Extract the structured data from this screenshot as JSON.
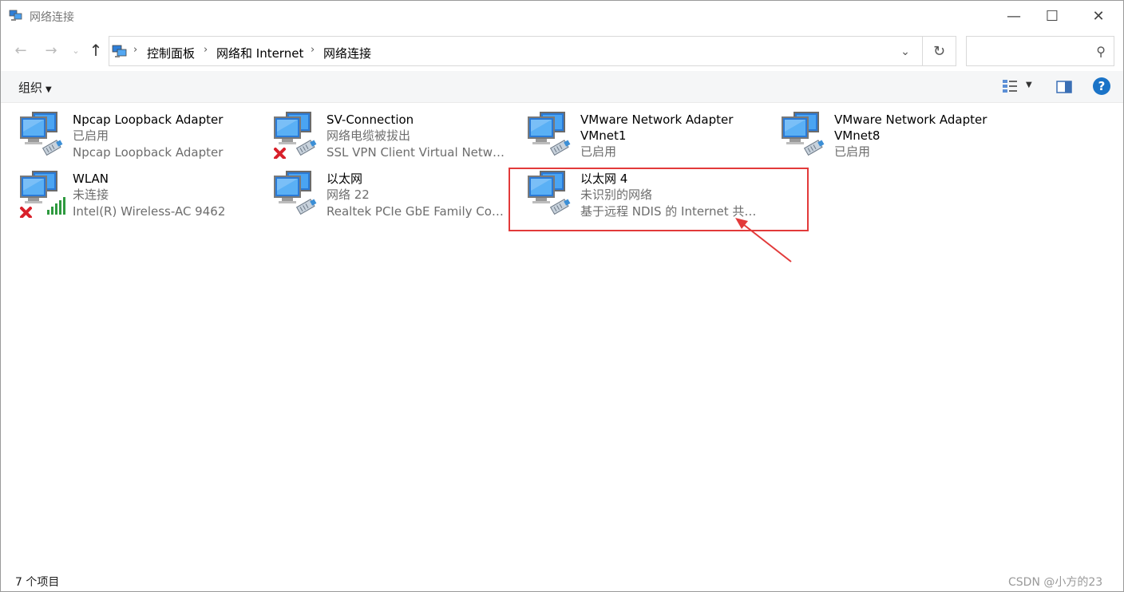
{
  "window": {
    "title": "网络连接",
    "minimize_label": "—",
    "maximize_label": "☐",
    "close_label": "✕"
  },
  "addressbar": {
    "breadcrumbs": [
      "控制面板",
      "网络和 Internet",
      "网络连接"
    ],
    "search_placeholder": ""
  },
  "toolbar": {
    "organize_label": "组织"
  },
  "connections": [
    {
      "name": "Npcap Loopback Adapter",
      "lines": [
        "已启用",
        "Npcap Loopback Adapter"
      ],
      "type": "ethernet",
      "disconnected": false
    },
    {
      "name": "SV-Connection",
      "lines": [
        "网络电缆被拔出",
        "SSL VPN Client Virtual Networ..."
      ],
      "type": "ethernet",
      "disconnected": true
    },
    {
      "name": "VMware Network Adapter",
      "lines": [
        "VMnet1",
        "已启用"
      ],
      "type": "ethernet",
      "disconnected": false,
      "name_black_lines": 1
    },
    {
      "name": "VMware Network Adapter",
      "lines": [
        "VMnet8",
        "已启用"
      ],
      "type": "ethernet",
      "disconnected": false,
      "name_black_lines": 1
    },
    {
      "name": "WLAN",
      "lines": [
        "未连接",
        "Intel(R) Wireless-AC 9462"
      ],
      "type": "wifi",
      "disconnected": true
    },
    {
      "name": "以太网",
      "lines": [
        "网络 22",
        "Realtek PCIe GbE Family Contr..."
      ],
      "type": "ethernet",
      "disconnected": false
    },
    {
      "name": "以太网 4",
      "lines": [
        "未识别的网络",
        "基于远程 NDIS 的 Internet 共享..."
      ],
      "type": "ethernet",
      "disconnected": false
    }
  ],
  "status": {
    "item_count": "7 个项目",
    "watermark": "CSDN @小方的23"
  },
  "colors": {
    "highlight_border": "#e23a3a",
    "help_blue": "#1a73c7"
  }
}
